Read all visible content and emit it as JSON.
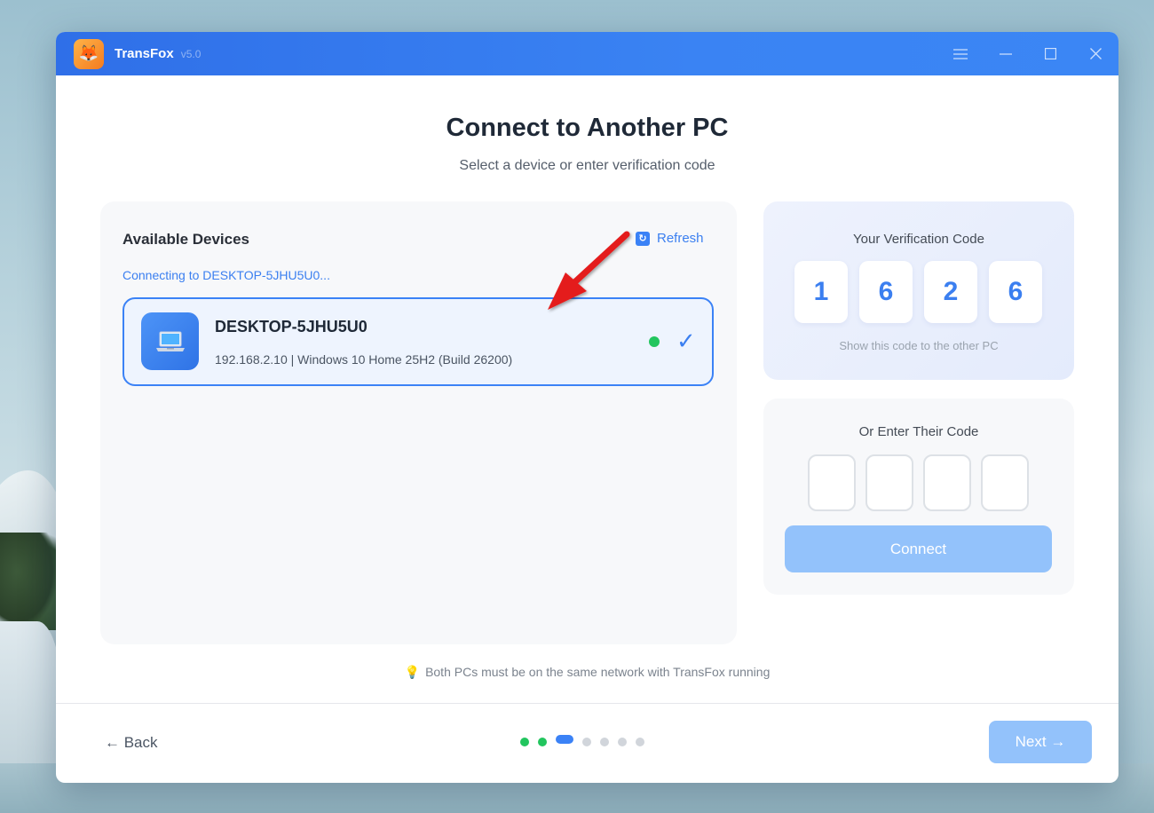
{
  "app": {
    "name": "TransFox",
    "version": "v5.0",
    "logo_icon": "fox-icon"
  },
  "page": {
    "title": "Connect to Another PC",
    "subtitle": "Select a device or enter verification code"
  },
  "devices": {
    "title": "Available Devices",
    "refresh_label": "Refresh",
    "status_text": "Connecting to DESKTOP-5JHU5U0...",
    "items": [
      {
        "name": "DESKTOP-5JHU5U0",
        "info": "192.168.2.10 | Windows 10 Home 25H2 (Build 26200)",
        "online": true,
        "selected": true
      }
    ]
  },
  "verification": {
    "title": "Your Verification Code",
    "digits": [
      "1",
      "6",
      "2",
      "6"
    ],
    "hint": "Show this code to the other PC"
  },
  "enter_code": {
    "title": "Or Enter Their Code",
    "values": [
      "",
      "",
      "",
      ""
    ],
    "connect_label": "Connect"
  },
  "network_hint": "Both PCs must be on the same network with TransFox running",
  "footer": {
    "back_label": "← Back",
    "next_label": "Next →",
    "steps_total": 7,
    "steps_done": 2,
    "current_step": 3
  },
  "colors": {
    "accent": "#3b82f6",
    "success": "#22c55e",
    "disabled_button": "#93c2fb"
  }
}
